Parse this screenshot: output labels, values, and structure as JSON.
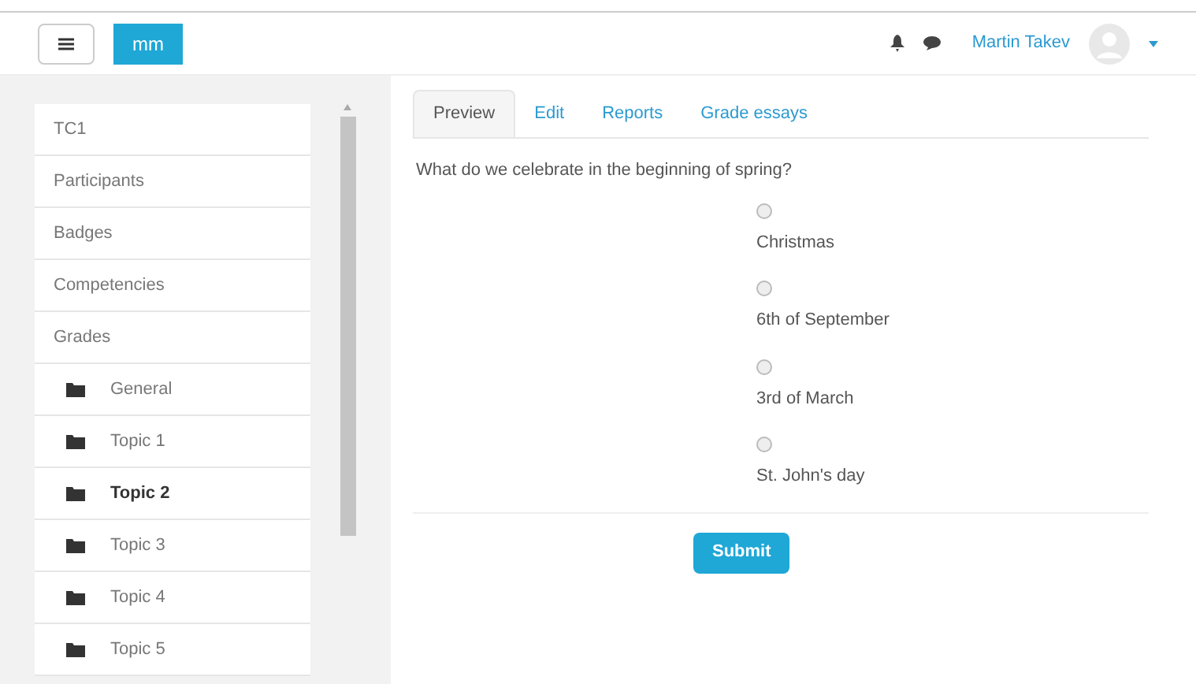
{
  "header": {
    "logo": "mm",
    "user_name": "Martin Takev"
  },
  "sidebar": {
    "items": [
      {
        "label": "TC1",
        "selected": false
      },
      {
        "label": "Participants",
        "selected": false
      },
      {
        "label": "Badges",
        "selected": false
      },
      {
        "label": "Competencies",
        "selected": false
      },
      {
        "label": "Grades",
        "selected": false,
        "children": [
          {
            "label": "General",
            "selected": false
          },
          {
            "label": "Topic 1",
            "selected": false
          },
          {
            "label": "Topic 2",
            "selected": true
          },
          {
            "label": "Topic 3",
            "selected": false
          },
          {
            "label": "Topic 4",
            "selected": false
          },
          {
            "label": "Topic 5",
            "selected": false
          }
        ]
      }
    ]
  },
  "tabs": [
    {
      "label": "Preview",
      "selected": true
    },
    {
      "label": "Edit",
      "selected": false
    },
    {
      "label": "Reports",
      "selected": false
    },
    {
      "label": "Grade essays",
      "selected": false
    }
  ],
  "question": {
    "text": "What do we celebrate in the beginning of spring?",
    "options": [
      {
        "label": "Christmas",
        "selected": false
      },
      {
        "label": "6th of September",
        "selected": false
      },
      {
        "label": "3rd of March",
        "selected": false
      },
      {
        "label": "St. John's day",
        "selected": false
      }
    ]
  },
  "submit_button": "Submit"
}
